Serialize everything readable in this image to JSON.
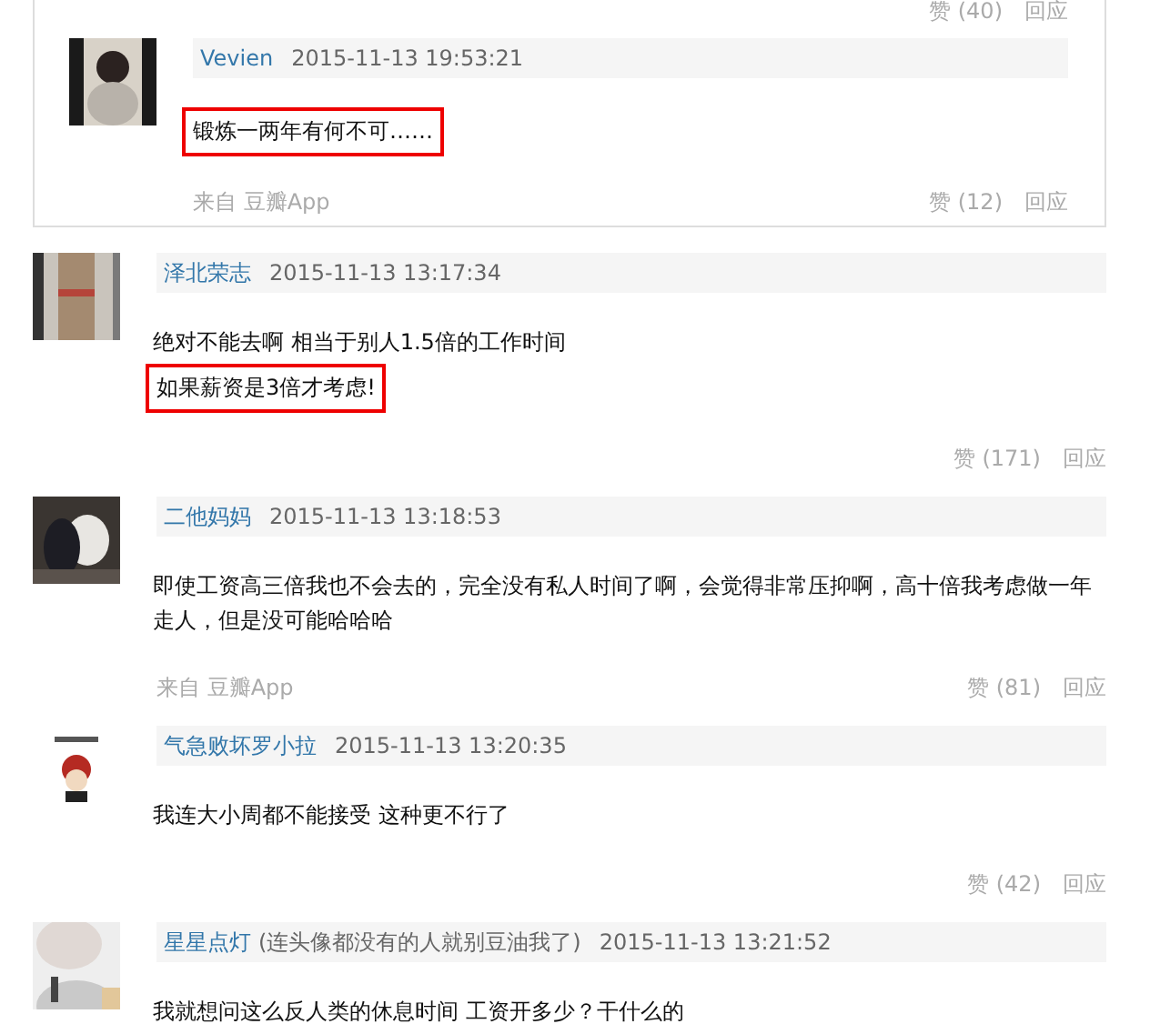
{
  "top_actions": {
    "likes": "赞 (40)",
    "reply": "回应"
  },
  "quoted_reply": {
    "user": "Vevien",
    "time": "2015-11-13 19:53:21",
    "lines": [
      {
        "text": "锻炼一两年有何不可……",
        "highlighted": true
      }
    ],
    "source": "来自 豆瓣App",
    "likes": "赞 (12)",
    "reply": "回应"
  },
  "comments": [
    {
      "user": "泽北荣志",
      "time": "2015-11-13 13:17:34",
      "lines": [
        {
          "text": "绝对不能去啊 相当于别人1.5倍的工作时间",
          "highlighted": false
        },
        {
          "text": "如果薪资是3倍才考虑!",
          "highlighted": true
        }
      ],
      "likes": "赞 (171)",
      "reply": "回应"
    },
    {
      "user": "二他妈妈",
      "time": "2015-11-13 13:18:53",
      "lines": [
        {
          "text": "即使工资高三倍我也不会去的，完全没有私人时间了啊，会觉得非常压抑啊，高十倍我考虑做一年走人，但是没可能哈哈哈",
          "highlighted": false
        }
      ],
      "source": "来自 豆瓣App",
      "likes": "赞 (81)",
      "reply": "回应"
    },
    {
      "user": "气急败坏罗小拉",
      "time": "2015-11-13 13:20:35",
      "lines": [
        {
          "text": "我连大小周都不能接受 这种更不行了",
          "highlighted": false
        }
      ],
      "likes": "赞 (42)",
      "reply": "回应"
    },
    {
      "user": "星星点灯",
      "note": "(连头像都没有的人就别豆油我了)",
      "time": "2015-11-13 13:21:52",
      "lines": [
        {
          "text": "我就想问这么反人类的休息时间 工资开多少？干什么的",
          "highlighted": false
        }
      ]
    }
  ]
}
